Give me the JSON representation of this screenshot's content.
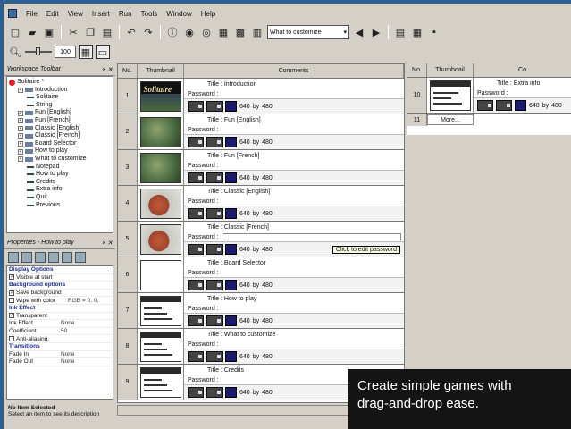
{
  "menu": {
    "items": [
      "File",
      "Edit",
      "View",
      "Insert",
      "Run",
      "Tools",
      "Window",
      "Help"
    ]
  },
  "toolbar": {
    "combo_value": "What to customize",
    "zoom": "100"
  },
  "workspace": {
    "title": "Workspace Toolbar",
    "tree": [
      {
        "label": "Solitaire *",
        "depth": 0,
        "kind": "app"
      },
      {
        "label": "Introduction",
        "depth": 1,
        "kind": "frame"
      },
      {
        "label": "Solitaire",
        "depth": 2,
        "kind": "obj"
      },
      {
        "label": "String",
        "depth": 2,
        "kind": "obj"
      },
      {
        "label": "Fun [English]",
        "depth": 1,
        "kind": "frame"
      },
      {
        "label": "Fun [French]",
        "depth": 1,
        "kind": "frame"
      },
      {
        "label": "Classic [English]",
        "depth": 1,
        "kind": "frame"
      },
      {
        "label": "Classic [French]",
        "depth": 1,
        "kind": "frame"
      },
      {
        "label": "Board Selector",
        "depth": 1,
        "kind": "frame"
      },
      {
        "label": "How to play",
        "depth": 1,
        "kind": "frame"
      },
      {
        "label": "What to customize",
        "depth": 1,
        "kind": "frame"
      },
      {
        "label": "Notepad",
        "depth": 2,
        "kind": "obj"
      },
      {
        "label": "How to play",
        "depth": 2,
        "kind": "obj"
      },
      {
        "label": "Credits",
        "depth": 2,
        "kind": "obj"
      },
      {
        "label": "Extra info",
        "depth": 2,
        "kind": "obj"
      },
      {
        "label": "Quit",
        "depth": 2,
        "kind": "obj"
      },
      {
        "label": "Previous",
        "depth": 2,
        "kind": "obj"
      }
    ]
  },
  "properties": {
    "title": "Properties - How to play",
    "rows": [
      {
        "type": "header",
        "key": "Display Options"
      },
      {
        "type": "check",
        "checked": true,
        "key": "Visible at start",
        "value": ""
      },
      {
        "type": "header",
        "key": "Background options"
      },
      {
        "type": "check",
        "checked": true,
        "key": "Save background",
        "value": ""
      },
      {
        "type": "check",
        "checked": false,
        "key": "Wipe with color",
        "value": "RGB = 0, 0,"
      },
      {
        "type": "header",
        "key": "Ink Effect"
      },
      {
        "type": "check",
        "checked": true,
        "key": "Transparent",
        "value": ""
      },
      {
        "type": "kv",
        "key": "Ink Effect",
        "value": "None"
      },
      {
        "type": "kv",
        "key": "Coefficient",
        "value": "50"
      },
      {
        "type": "check",
        "checked": false,
        "key": "Anti-aliasing",
        "value": ""
      },
      {
        "type": "header",
        "key": "Transitions"
      },
      {
        "type": "kv",
        "key": "Fade In",
        "value": "None"
      },
      {
        "type": "kv",
        "key": "Fade Out",
        "value": "None"
      }
    ],
    "desc_title": "No Item Selected",
    "desc_text": "Select an item to see its description"
  },
  "frames": {
    "headers": {
      "no": "No.",
      "thumb": "Thumbnail",
      "comments": "Comments"
    },
    "title_label": "Title :",
    "password_label": "Password :",
    "size_by": "by",
    "rows": [
      {
        "no": "1",
        "title": "Introduction",
        "thumb": "sol",
        "w": "640",
        "h": "480",
        "tip": ""
      },
      {
        "no": "2",
        "title": "Fun [English]",
        "thumb": "grn",
        "w": "640",
        "h": "480",
        "tip": ""
      },
      {
        "no": "3",
        "title": "Fun [French]",
        "thumb": "grn",
        "w": "640",
        "h": "480",
        "tip": ""
      },
      {
        "no": "4",
        "title": "Classic [English]",
        "thumb": "red",
        "w": "640",
        "h": "480",
        "tip": ""
      },
      {
        "no": "5",
        "title": "Classic [French]",
        "thumb": "red",
        "w": "640",
        "h": "480",
        "tip": "Click to edit password"
      },
      {
        "no": "6",
        "title": "Board Selector",
        "thumb": "wht",
        "w": "640",
        "h": "480",
        "tip": ""
      },
      {
        "no": "7",
        "title": "How to play",
        "thumb": "scr",
        "w": "640",
        "h": "480",
        "tip": ""
      },
      {
        "no": "8",
        "title": "What to customize",
        "thumb": "scr",
        "w": "640",
        "h": "480",
        "tip": ""
      },
      {
        "no": "9",
        "title": "Credits",
        "thumb": "scr",
        "w": "640",
        "h": "480",
        "tip": ""
      }
    ]
  },
  "right_frames": {
    "headers": {
      "no": "No.",
      "thumb": "Thumbnail",
      "comments": "Co"
    },
    "row10": {
      "no": "10",
      "title": "Extra info",
      "w": "640",
      "h": "480",
      "by": "by"
    },
    "row11": {
      "no": "11",
      "more": "More..."
    }
  },
  "caption": {
    "line1": "Create simple games with",
    "line2": "drag-and-drop ease."
  }
}
